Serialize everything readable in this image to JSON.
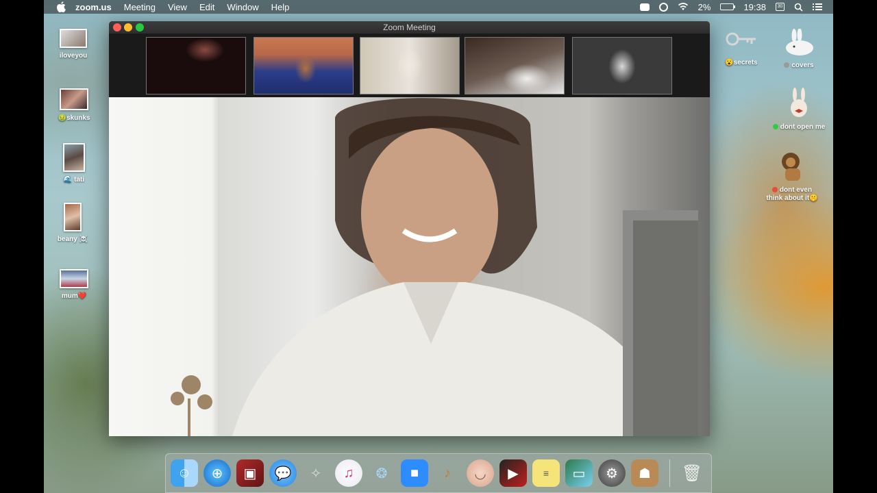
{
  "menubar": {
    "app_name": "zoom.us",
    "menus": [
      "Meeting",
      "View",
      "Edit",
      "Window",
      "Help"
    ],
    "battery": "2%",
    "time": "19:38",
    "calendar_day": "30"
  },
  "window": {
    "title": "Zoom Meeting"
  },
  "desktop_left": [
    {
      "label": "iloveyou",
      "emoji": ""
    },
    {
      "label": "skunks",
      "emoji": "🤢"
    },
    {
      "label": "tati",
      "emoji": "🌊"
    },
    {
      "label": "beany",
      "emoji": "☠️"
    },
    {
      "label": "mum",
      "emoji": "❤️"
    }
  ],
  "desktop_right": [
    {
      "label": "secrets",
      "prefix": "😮"
    },
    {
      "label": "covers",
      "tag_color": "#9a9a9a"
    },
    {
      "label": "dont open me",
      "tag_color": "#2ecc40"
    },
    {
      "label_line1": "dont even",
      "label_line2": "think about it",
      "suffix": "🤫",
      "tag_color": "#e74c3c"
    }
  ],
  "dock": {
    "apps": [
      "finder-icon",
      "safari-icon",
      "photo-booth-icon",
      "messages-icon",
      "inkscape-icon",
      "itunes-icon",
      "seal-app-icon",
      "zoom-icon",
      "garageband-icon",
      "face-app-icon",
      "photo-slideshow-icon",
      "stickies-icon",
      "preview-icon",
      "system-preferences-icon",
      "contacts-icon",
      "trash-icon"
    ]
  }
}
